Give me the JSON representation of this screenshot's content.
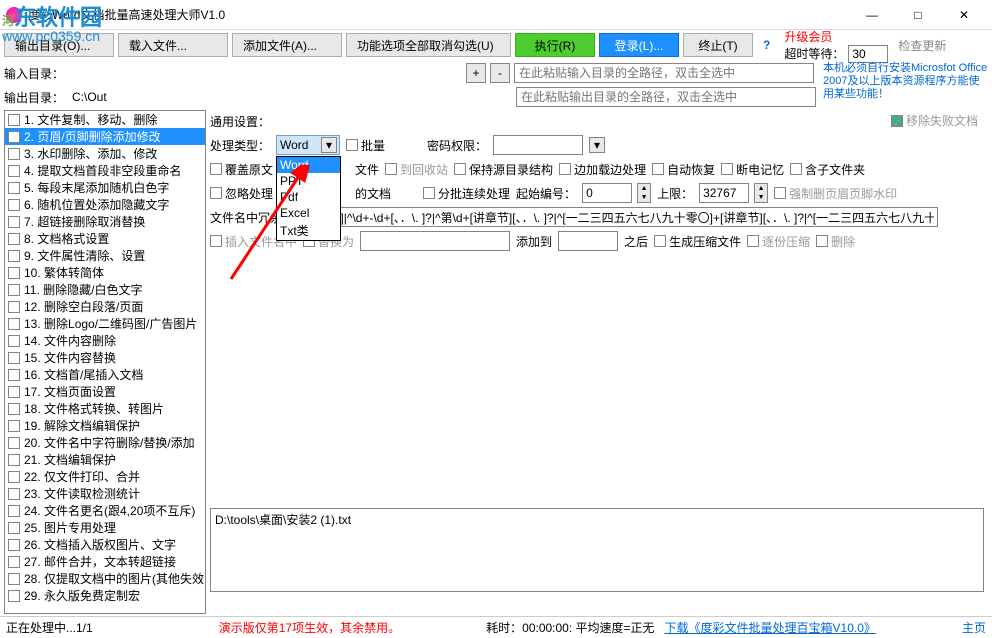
{
  "title": "度彩Word文档批量高速处理大师V1.0",
  "win": {
    "min": "—",
    "max": "□",
    "close": "✕"
  },
  "toolbar": {
    "output_dir_btn": "输出目录(O)...",
    "load_file": "载入文件...",
    "add_file": "添加文件(A)...",
    "func_cancel": "功能选项全部取消勾选(U)",
    "execute": "执行(R)",
    "login": "登录(L)...",
    "stop": "终止(T)"
  },
  "upgrade": {
    "link": "升级会员",
    "timeout_label": "超时等待：",
    "timeout_value": "30",
    "check": "检查更新"
  },
  "dirs": {
    "in_label": "输入目录：",
    "out_label": "输出目录：",
    "out_path": "C:\\Out",
    "in_placeholder": "在此粘贴输入目录的全路径，双击全选中",
    "out_placeholder": "在此粘贴输出目录的全路径，双击全选中"
  },
  "info_box": "本机必须自行安装Microsfot Office 2007及以上版本资源程序方能使用某些功能！",
  "rm_fail": "移除失败文档",
  "sidebar": [
    "1. 文件复制、移动、删除",
    "2. 页眉/页脚删除添加修改",
    "3. 水印删除、添加、修改",
    "4. 提取文档首段非空段重命名",
    "5. 每段末尾添加随机白色字",
    "6. 随机位置处添加隐藏文字",
    "7. 超链接删除取消替换",
    "8. 文档格式设置",
    "9. 文件属性清除、设置",
    "10. 繁体转简体",
    "11. 删除隐藏/白色文字",
    "12. 删除空白段落/页面",
    "13. 删除Logo/二维码图/广告图片",
    "14. 文件内容删除",
    "15. 文件内容替换",
    "16. 文档首/尾插入文档",
    "17. 文档页面设置",
    "18. 文件格式转换、转图片",
    "19. 解除文档编辑保护",
    "20. 文件名中字符删除/替换/添加",
    "21. 文档编辑保护",
    "22. 仅文件打印、合并",
    "23. 文件读取检测统计",
    "24. 文件名更名(跟4,20项不互斥)",
    "25. 图片专用处理",
    "26. 文档插入版权图片、文字",
    "27. 邮件合并，文本转超链接",
    "28. 仅提取文档中的图片(其他失效",
    "29. 永久版免费定制宏"
  ],
  "sidebar_selected": 1,
  "settings": {
    "general_label": "通用设置：",
    "proc_type_label": "处理类型：",
    "proc_type_value": "Word",
    "dropdown_items": [
      "Word",
      "PPT",
      "Pdf",
      "Excel",
      "Txt类"
    ],
    "batch": "批量",
    "pwd_perm": "密码权限：",
    "overwrite": "覆盖原文",
    "overwrite_suffix": "文件",
    "recycle": "到回收站",
    "keep_struct": "保持源目录结构",
    "edge_proc": "边加载边处理",
    "auto_recover": "自动恢复",
    "break_mem": "断电记忆",
    "sub_folder": "含子文件夹",
    "ignore_proc": "忽略处理",
    "ignore_suffix": "的文档",
    "split_proc": "分批连续处理",
    "start_num_label": "起始编号：",
    "start_num": "0",
    "upper_label": "上限：",
    "upper": "32767",
    "force_del": "强制删页眉页脚水印",
    "filename_redundant": "文件名中冗余",
    "filename_pattern": "\\d+[、．\\. ]|^\\d+-\\d+[、．\\. ]?|^第\\d+[讲章节][、．\\. ]?|^[一二三四五六七八九十零〇]+[讲章节][、．\\. ]?|^[一二三四五六七八九十零",
    "insert_filename": "插入文件名中",
    "replace_with": "替换为",
    "add_to": "添加到",
    "after": "之后",
    "gen_zip": "生成压缩文件",
    "per_zip": "逐份压缩",
    "delete": "删除"
  },
  "file_list": [
    "D:\\tools\\桌面\\安装2 (1).txt"
  ],
  "status": {
    "processing": "正在处理中...1/1",
    "demo": "演示版仅第17项生效，其余禁用。",
    "elapsed": "耗时：00:00:00: 平均速度=正无",
    "download": "下载《度彩文件批量处理百宝箱V10.0》",
    "home": "主页"
  }
}
